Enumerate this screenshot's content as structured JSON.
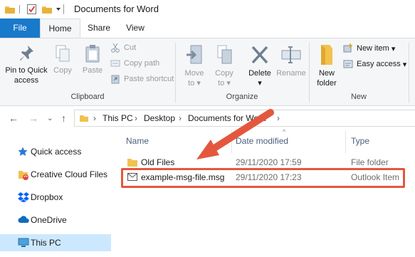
{
  "window": {
    "title": "Documents for Word"
  },
  "ribbon_tabs": [
    "File",
    "Home",
    "Share",
    "View"
  ],
  "clipboard": {
    "pin_label_1": "Pin to Quick",
    "pin_label_2": "access",
    "copy": "Copy",
    "paste": "Paste",
    "cut": "Cut",
    "copy_path": "Copy path",
    "paste_shortcut": "Paste shortcut",
    "group": "Clipboard"
  },
  "organize": {
    "move_to_1": "Move",
    "move_to_2": "to",
    "copy_to_1": "Copy",
    "copy_to_2": "to",
    "delete": "Delete",
    "rename": "Rename",
    "group": "Organize"
  },
  "new": {
    "new_folder_1": "New",
    "new_folder_2": "folder",
    "new_item": "New item",
    "easy_access": "Easy access",
    "group": "New"
  },
  "address": {
    "crumbs": [
      "This PC",
      "Desktop",
      "Documents for Word"
    ]
  },
  "nav_pane": [
    {
      "label": "Quick access",
      "icon": "star-icon"
    },
    {
      "label": "Creative Cloud Files",
      "icon": "creative-cloud-folder-icon"
    },
    {
      "label": "Dropbox",
      "icon": "dropbox-icon"
    },
    {
      "label": "OneDrive",
      "icon": "onedrive-cloud-icon"
    },
    {
      "label": "This PC",
      "icon": "computer-icon"
    }
  ],
  "columns": [
    "Name",
    "Date modified",
    "Type"
  ],
  "files": [
    {
      "name": "Old Files",
      "date": "29/11/2020 17:59",
      "type": "File folder",
      "icon": "folder-icon"
    },
    {
      "name": "example-msg-file.msg",
      "date": "29/11/2020 17:23",
      "type": "Outlook Item",
      "icon": "mail-icon"
    }
  ],
  "colors": {
    "accent": "#1979ca",
    "highlight": "#e4573e",
    "selected": "#cce8ff",
    "folder": "#f2c14e"
  }
}
